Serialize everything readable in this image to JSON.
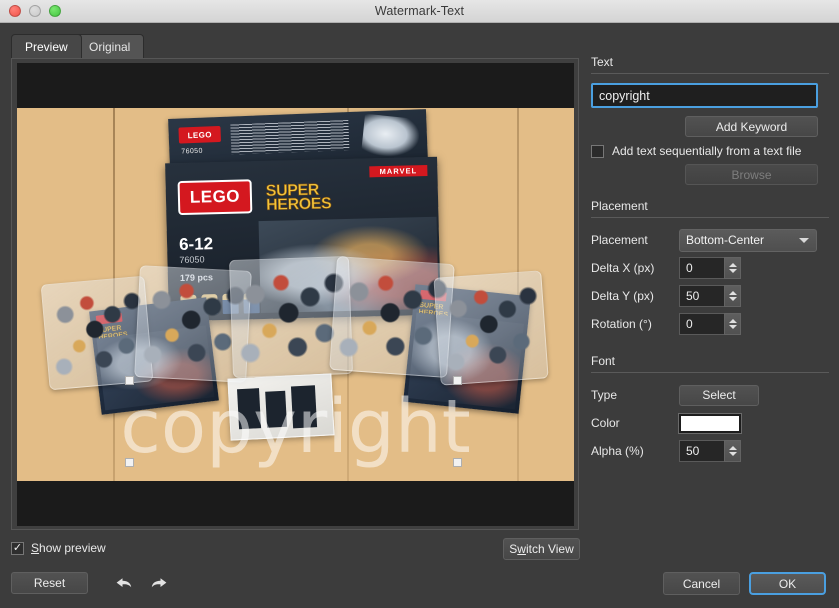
{
  "window": {
    "title": "Watermark-Text",
    "traffic_lights": [
      "close-button",
      "minimize-button",
      "zoom-button"
    ]
  },
  "tabs": [
    {
      "label": "Preview",
      "active": true
    },
    {
      "label": "Original",
      "active": false
    }
  ],
  "preview": {
    "watermark_text": "copyright",
    "photo_description": "LEGO Marvel Super Heroes 76050 box with parts bags on a wooden table",
    "lego": {
      "brand": "LEGO",
      "theme_top": "MARVEL",
      "title_line1": "SUPER",
      "title_line2": "HEROES",
      "age_range": "6-12",
      "set_number": "76050",
      "piece_count": "179 pcs",
      "sku_small": "76050"
    }
  },
  "show_preview": {
    "label_prefix": "S",
    "label_rest": "how preview",
    "checked_glyph": "✓",
    "checked": true
  },
  "switch_view": {
    "label_prefix": "S",
    "label_mid": "w",
    "label_rest": "itch View",
    "full_label": "Switch View"
  },
  "right_panel": {
    "text_section": {
      "heading": "Text",
      "input_value": "copyright",
      "input_placeholder": "",
      "add_keyword_label": "Add Keyword",
      "sequential_checkbox_label": "Add text sequentially from a text file",
      "sequential_checked": false,
      "browse_label": "Browse",
      "browse_disabled": true
    },
    "placement_section": {
      "heading": "Placement",
      "placement_label": "Placement",
      "placement_value": "Bottom-Center",
      "placement_options": [
        "Bottom-Center"
      ],
      "delta_x_label": "Delta X (px)",
      "delta_x_value": "0",
      "delta_y_label": "Delta Y (px)",
      "delta_y_value": "50",
      "rotation_label": "Rotation (°)",
      "rotation_value": "0"
    },
    "font_section": {
      "heading": "Font",
      "type_label": "Type",
      "select_label": "Select",
      "color_label": "Color",
      "color_value": "#ffffff",
      "alpha_label": "Alpha (%)",
      "alpha_value": "50"
    }
  },
  "footer": {
    "reset_label": "Reset",
    "undo_icon": "undo-arrow-icon",
    "redo_icon": "redo-arrow-icon",
    "cancel_label": "Cancel",
    "ok_label": "OK"
  },
  "colors": {
    "accent_blue": "#4a9fe0",
    "window_bg": "#3c3c3c",
    "panel_bg": "#3f3f3f",
    "field_bg": "#262626",
    "text": "#e8e8e8",
    "lego_red": "#d4181f",
    "lego_yellow": "#f2c53b"
  }
}
